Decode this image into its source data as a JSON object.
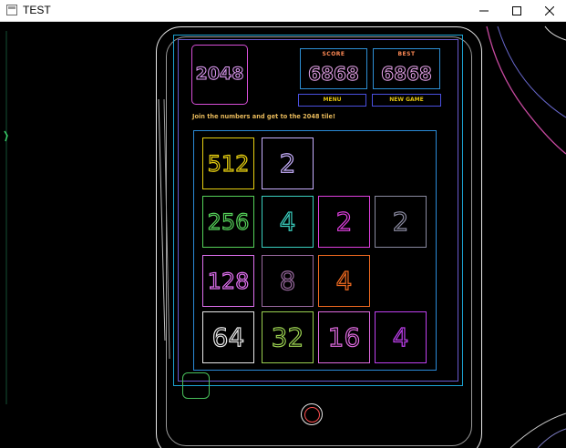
{
  "window": {
    "title": "TEST",
    "controls": {
      "minimize_icon": "minimize-icon",
      "maximize_icon": "maximize-icon",
      "close_icon": "close-icon"
    }
  },
  "game": {
    "logo": "2048",
    "scores": [
      {
        "label": "SCORE",
        "value": "6868"
      },
      {
        "label": "BEST",
        "value": "6868"
      }
    ],
    "buttons": [
      {
        "label": "MENU"
      },
      {
        "label": "NEW GAME"
      }
    ],
    "tagline": "Join the numbers and get to the 2048 tile!",
    "board": {
      "rows": [
        [
          {
            "value": "512",
            "color": "#e8d010"
          },
          {
            "value": "2",
            "color": "#c8b0ff"
          },
          {
            "value": "",
            "color": ""
          },
          {
            "value": "",
            "color": ""
          }
        ],
        [
          {
            "value": "256",
            "color": "#56d35a"
          },
          {
            "value": "4",
            "color": "#3ad0c0"
          },
          {
            "value": "2",
            "color": "#e040e0"
          },
          {
            "value": "2",
            "color": "#8a8aa0"
          }
        ],
        [
          {
            "value": "128",
            "color": "#e070f0"
          },
          {
            "value": "8",
            "color": "#9a6aa0"
          },
          {
            "value": "4",
            "color": "#f06a20"
          },
          {
            "value": "",
            "color": ""
          }
        ],
        [
          {
            "value": "64",
            "color": "#e8e8e8"
          },
          {
            "value": "32",
            "color": "#9ad050"
          },
          {
            "value": "16",
            "color": "#e06ae0"
          },
          {
            "value": "4",
            "color": "#c040f0"
          }
        ]
      ]
    }
  },
  "colors": {
    "tablet_outline": "#e8e8e8",
    "screen_outline": "#1ca4d4",
    "board_outline": "#2a8ad8"
  }
}
